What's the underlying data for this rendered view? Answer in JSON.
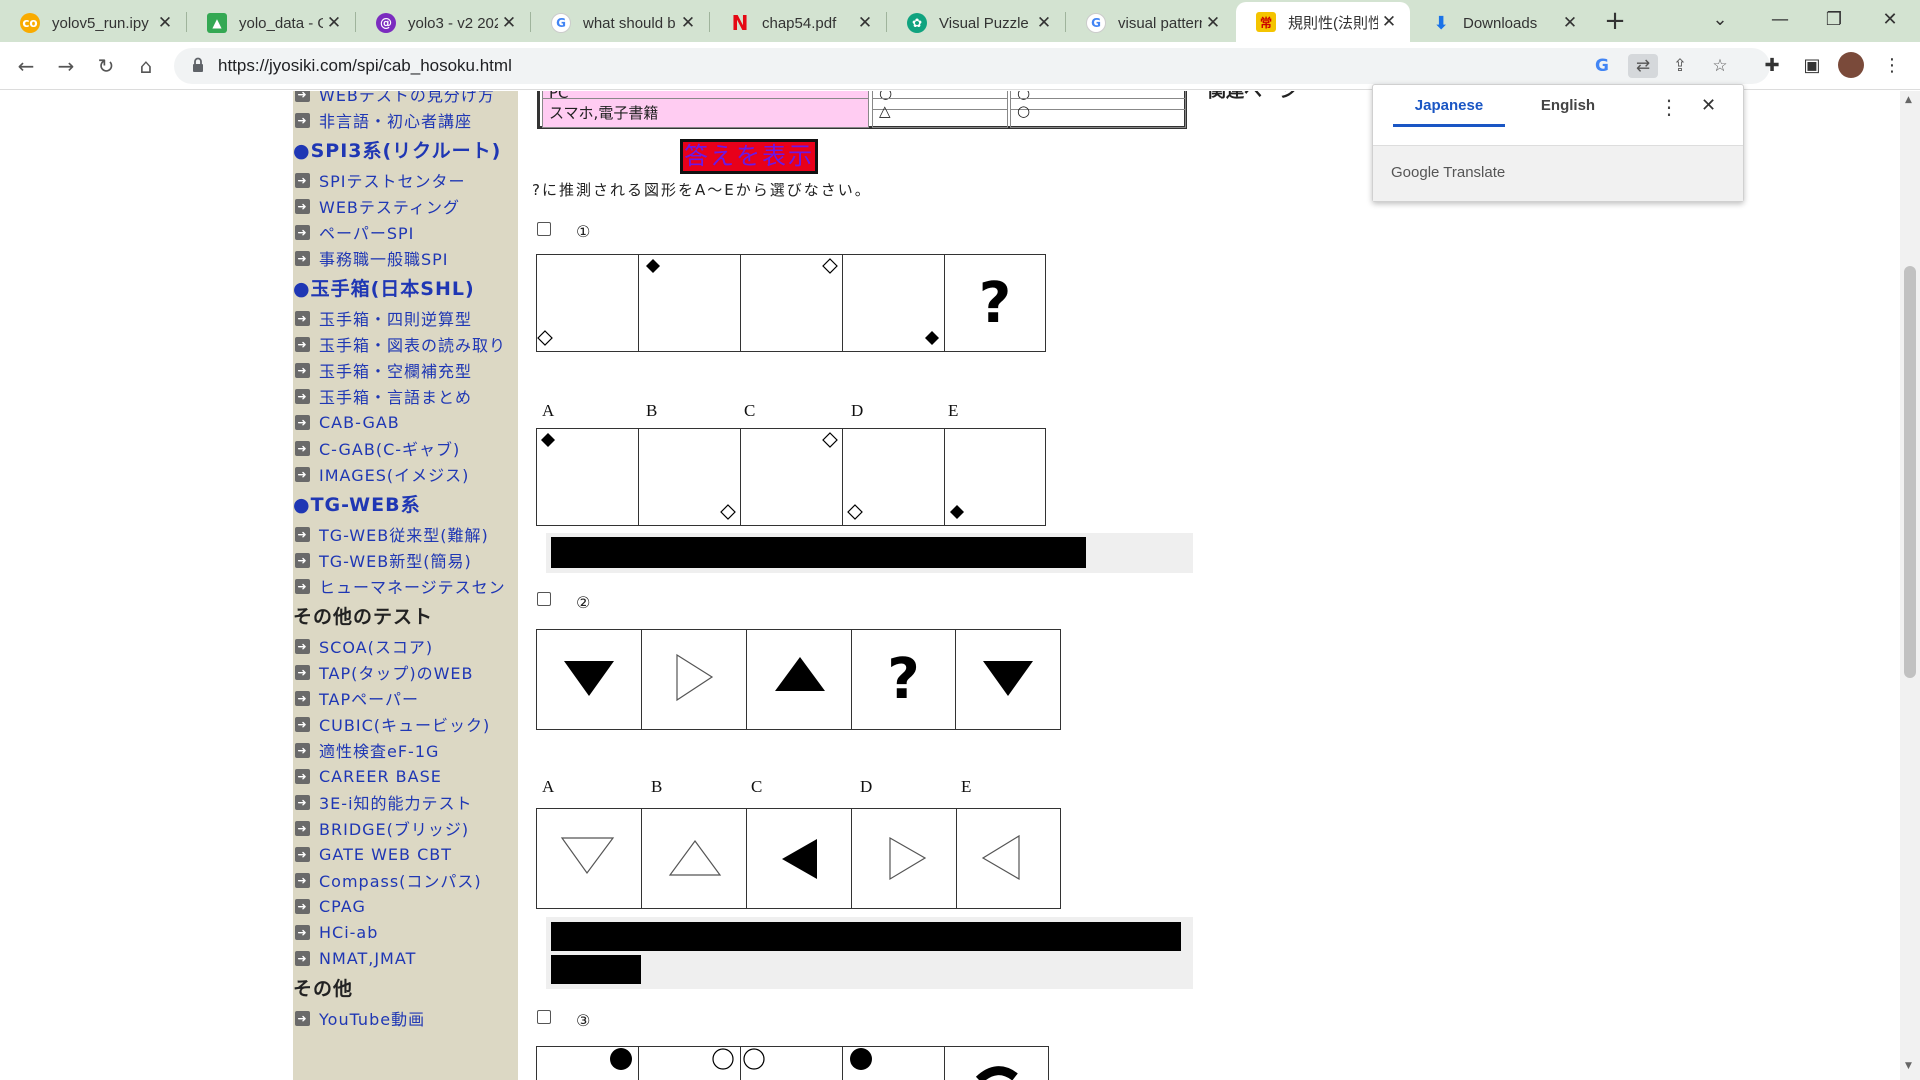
{
  "browser": {
    "tabs": [
      {
        "title": "yolov5_run.ipy",
        "favicon": "colab-icon",
        "color": "#f9ab00"
      },
      {
        "title": "yolo_data - Go",
        "favicon": "drive-icon",
        "color": "#34a853"
      },
      {
        "title": "yolo3 - v2 202",
        "favicon": "roboflow-icon",
        "color": "#7b2cbf"
      },
      {
        "title": "what should b",
        "favicon": "google-icon",
        "color": "#4285f4"
      },
      {
        "title": "chap54.pdf",
        "favicon": "netflix-n-icon",
        "color": "#e50914"
      },
      {
        "title": "Visual Puzzle S",
        "favicon": "openai-icon",
        "color": "#10a37f"
      },
      {
        "title": "visual pattern",
        "favicon": "google-icon",
        "color": "#4285f4"
      },
      {
        "title": "規則性(法則性",
        "favicon": "jyosiki-icon",
        "color": "#f4c400"
      },
      {
        "title": "Downloads",
        "favicon": "download-icon",
        "color": "#1a73e8"
      }
    ],
    "active_tab": 7,
    "url": "https://jyosiki.com/spi/cab_hosoku.html"
  },
  "sidebar": {
    "groups": [
      {
        "type": "item",
        "label": "WEBテストの見分け方"
      },
      {
        "type": "item",
        "label": "非言語・初心者講座"
      },
      {
        "type": "head",
        "label": "●SPI3系(リクルート)"
      },
      {
        "type": "item",
        "label": "SPIテストセンター"
      },
      {
        "type": "item",
        "label": "WEBテスティング"
      },
      {
        "type": "item",
        "label": "ペーパーSPI"
      },
      {
        "type": "item",
        "label": "事務職一般職SPI"
      },
      {
        "type": "head",
        "label": "●玉手箱(日本SHL)"
      },
      {
        "type": "item",
        "label": "玉手箱・四則逆算型"
      },
      {
        "type": "item",
        "label": "玉手箱・図表の読み取り"
      },
      {
        "type": "item",
        "label": "玉手箱・空欄補充型"
      },
      {
        "type": "item",
        "label": "玉手箱・言語まとめ"
      },
      {
        "type": "item",
        "label": "CAB-GAB"
      },
      {
        "type": "item",
        "label": "C-GAB(C-ギャブ)"
      },
      {
        "type": "item",
        "label": "IMAGES(イメジス)"
      },
      {
        "type": "head",
        "label": "●TG-WEB系"
      },
      {
        "type": "item",
        "label": "TG-WEB従来型(難解)"
      },
      {
        "type": "item",
        "label": "TG-WEB新型(簡易)"
      },
      {
        "type": "item",
        "label": "ヒューマネージテスセン"
      },
      {
        "type": "plainhead",
        "label": "その他のテスト"
      },
      {
        "type": "item",
        "label": "SCOA(スコア)"
      },
      {
        "type": "item",
        "label": "TAP(タップ)のWEB"
      },
      {
        "type": "item",
        "label": "TAPペーパー"
      },
      {
        "type": "item",
        "label": "CUBIC(キュービック)"
      },
      {
        "type": "item",
        "label": "適性検査eF-1G"
      },
      {
        "type": "item",
        "label": "CAREER BASE"
      },
      {
        "type": "item",
        "label": "3E-i知的能力テスト"
      },
      {
        "type": "item",
        "label": "BRIDGE(ブリッジ)"
      },
      {
        "type": "item",
        "label": "GATE WEB CBT"
      },
      {
        "type": "item",
        "label": "Compass(コンパス)"
      },
      {
        "type": "item",
        "label": "CPAG"
      },
      {
        "type": "item",
        "label": "HCi-ab"
      },
      {
        "type": "item",
        "label": "NMAT,JMAT"
      },
      {
        "type": "plainhead",
        "label": "その他"
      },
      {
        "type": "item",
        "label": "YouTube動画"
      }
    ]
  },
  "main": {
    "top_table": {
      "row1": [
        "PC",
        "○",
        "○"
      ],
      "row2": [
        "スマホ,電子書籍",
        "△",
        "○"
      ]
    },
    "show_answer_button": "答えを表示",
    "instruction": "?に推測される図形をA～Eから選びなさい。",
    "right_heading": "関連ページ",
    "questions": [
      {
        "number": "①",
        "options": [
          "A",
          "B",
          "C",
          "D",
          "E"
        ],
        "question_mark": "?"
      },
      {
        "number": "②",
        "options": [
          "A",
          "B",
          "C",
          "D",
          "E"
        ],
        "question_mark": "?"
      },
      {
        "number": "③"
      }
    ]
  },
  "translate_popup": {
    "tab_japanese": "Japanese",
    "tab_english": "English",
    "brand": "Google Translate"
  }
}
